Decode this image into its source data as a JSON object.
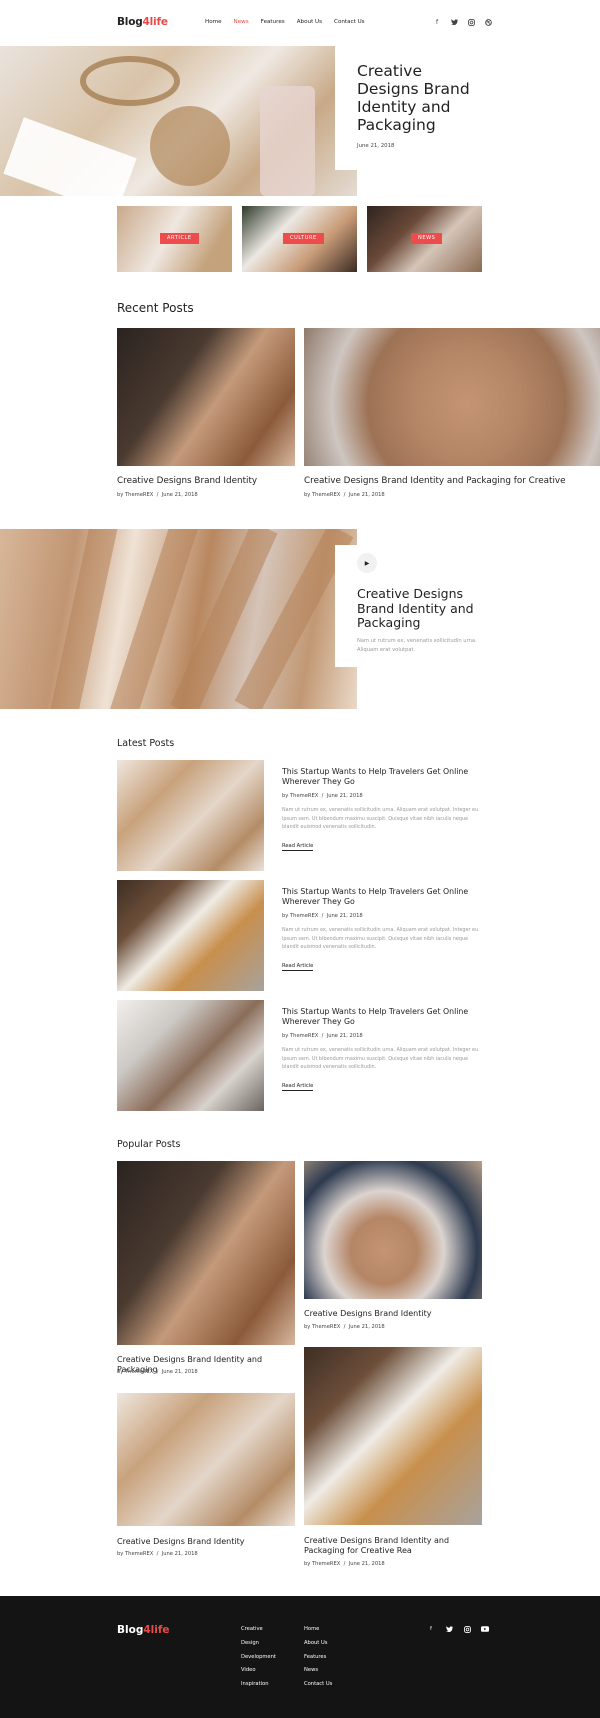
{
  "header": {
    "logo_main": "Blog",
    "logo_accent": "4life",
    "nav": [
      "Home",
      "News",
      "Features",
      "About Us",
      "Contact Us"
    ],
    "active_nav": "News",
    "social_icons": [
      "facebook-icon",
      "twitter-icon",
      "instagram-icon",
      "dribbble-icon"
    ]
  },
  "hero": {
    "title": "Creative Designs Brand Identity and Packaging",
    "date": "June 21, 2018"
  },
  "categories": [
    {
      "label": "ARTICLE"
    },
    {
      "label": "CULTURE"
    },
    {
      "label": "NEWS"
    }
  ],
  "recent": {
    "heading": "Recent Posts",
    "posts": [
      {
        "title": "Creative Designs Brand Identity",
        "author": "by ThemeREX",
        "date": "June 21, 2018"
      },
      {
        "title": "Creative Designs Brand Identity and Packaging for Creative",
        "author": "by ThemeREX",
        "date": "June 21, 2018"
      }
    ]
  },
  "feature": {
    "title": "Creative Designs Brand Identity and Packaging",
    "description": "Nam ut rutrum ex, venenatis sollicitudin urna. Aliquam erat volutpat."
  },
  "latest": {
    "heading": "Latest Posts",
    "posts": [
      {
        "title": "This Startup Wants to Help Travelers Get Online Wherever They Go",
        "author": "by ThemeREX",
        "date": "June 21, 2018",
        "desc": "Nam ut rutrum ex, venenatis sollicitudin urna. Aliquam erat volutpat. Integer eu ipsum sem. Ut bibendum maximu suscipit. Quisque vitae nibh iaculis neque blandit euismod venenatis sollicitudin.",
        "link": "Read Article"
      },
      {
        "title": "This Startup Wants to Help Travelers Get Online Wherever They Go",
        "author": "by ThemeREX",
        "date": "June 21, 2018",
        "desc": "Nam ut rutrum ex, venenatis sollicitudin urna. Aliquam erat volutpat. Integer eu ipsum sem. Ut bibendum maximu suscipit. Quisque vitae nibh iaculis neque blandit euismod venenatis sollicitudin.",
        "link": "Read Article"
      },
      {
        "title": "This Startup Wants to Help Travelers Get Online Wherever They Go",
        "author": "by ThemeREX",
        "date": "June 21, 2018",
        "desc": "Nam ut rutrum ex, venenatis sollicitudin urna. Aliquam erat volutpat. Integer eu ipsum sem. Ut bibendum maximu suscipit. Quisque vitae nibh iaculis neque blandit euismod venenatis sollicitudin.",
        "link": "Read Article"
      }
    ]
  },
  "popular": {
    "heading": "Popular Posts",
    "posts": [
      {
        "title": "Creative Designs Brand Identity and Packaging",
        "author": "by ThemeREX",
        "date": "June 21, 2018"
      },
      {
        "title": "Creative Designs Brand Identity",
        "author": "by ThemeREX",
        "date": "June 21, 2018"
      },
      {
        "title": "Creative Designs Brand Identity",
        "author": "by ThemeREX",
        "date": "June 21, 2018"
      },
      {
        "title": "Creative Designs Brand Identity and Packaging for Creative  Rea",
        "author": "by ThemeREX",
        "date": "June 21, 2018"
      }
    ]
  },
  "footer": {
    "logo_main": "Blog",
    "logo_accent": "4life",
    "col1": [
      "Creative",
      "Design",
      "Development",
      "Video",
      "Inspiration"
    ],
    "col2": [
      "Home",
      "About Us",
      "Features",
      "News",
      "Contact Us"
    ],
    "social_icons": [
      "facebook-icon",
      "twitter-icon",
      "instagram-icon",
      "youtube-icon"
    ]
  },
  "colors": {
    "accent": "#e84a4a",
    "footer_bg": "#151414"
  }
}
